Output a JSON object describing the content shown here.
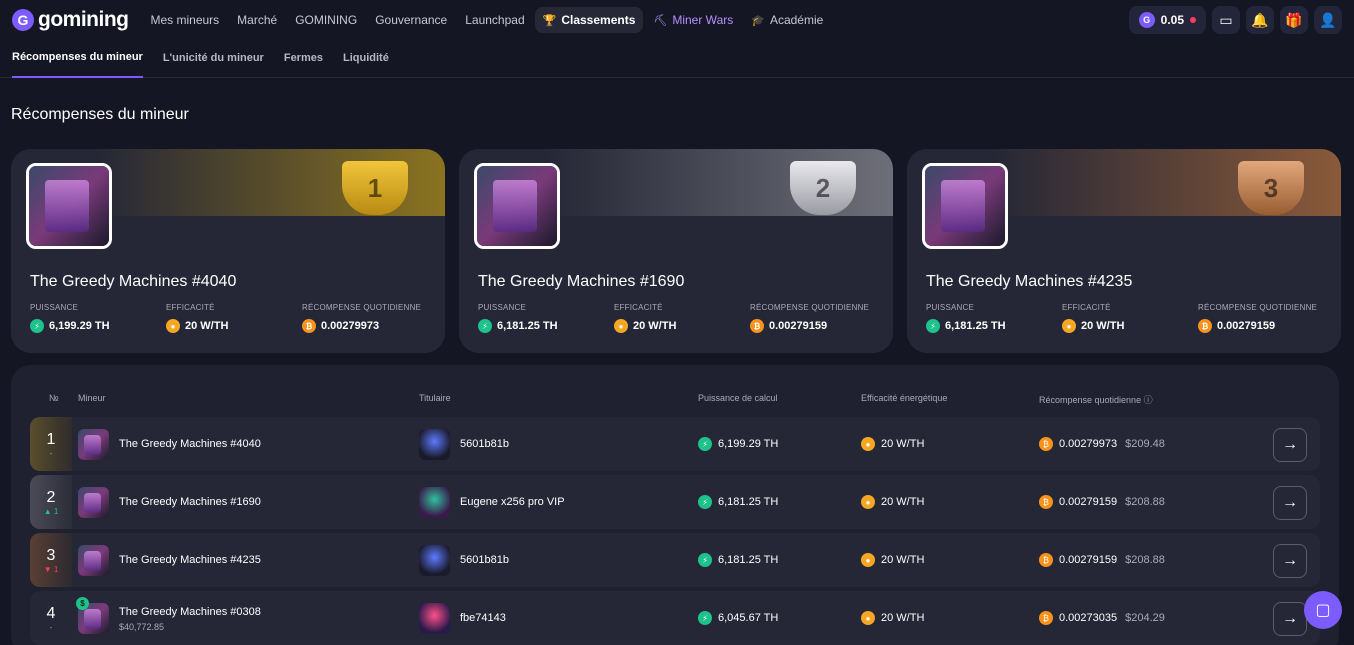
{
  "brand": {
    "logo_letter": "G",
    "logo_text": "gomining"
  },
  "nav": [
    {
      "label": "Mes mineurs"
    },
    {
      "label": "Marché"
    },
    {
      "label": "GOMINING"
    },
    {
      "label": "Gouvernance"
    },
    {
      "label": "Launchpad"
    },
    {
      "label": "Classements",
      "icon": "🏆"
    },
    {
      "label": "Miner Wars",
      "icon": "⛏"
    },
    {
      "label": "Académie",
      "icon": "🎓"
    }
  ],
  "header": {
    "balance": "0.05",
    "coin_letter": "G"
  },
  "subtabs": [
    "Récompenses du mineur",
    "L'unicité du mineur",
    "Fermes",
    "Liquidité"
  ],
  "section_title": "Récompenses du mineur",
  "podium": [
    {
      "rank_label": "1",
      "name": "The Greedy Machines #4040",
      "power": "6,199.29 TH",
      "efficiency": "20 W/TH",
      "reward": "0.00279973"
    },
    {
      "rank_label": "2",
      "name": "The Greedy Machines #1690",
      "power": "6,181.25 TH",
      "efficiency": "20 W/TH",
      "reward": "0.00279159"
    },
    {
      "rank_label": "3",
      "name": "The Greedy Machines #4235",
      "power": "6,181.25 TH",
      "efficiency": "20 W/TH",
      "reward": "0.00279159"
    }
  ],
  "stat_labels": {
    "power": "PUISSANCE",
    "efficiency": "EFFICACITÉ",
    "reward": "RÉCOMPENSE QUOTIDIENNE"
  },
  "table": {
    "headers": {
      "rank": "№",
      "miner": "Mineur",
      "owner": "Titulaire",
      "power": "Puissance de calcul",
      "efficiency": "Efficacité énergétique",
      "reward": "Récompense quotidienne ⓘ"
    },
    "rows": [
      {
        "rank": "1",
        "delta": "-",
        "name": "The Greedy Machines #4040",
        "owner": "5601b81b",
        "power": "6,199.29 TH",
        "efficiency": "20 W/TH",
        "reward": "0.00279973",
        "usd": "$209.48"
      },
      {
        "rank": "2",
        "delta": "▲ 1",
        "name": "The Greedy Machines #1690",
        "owner": "Eugene x256 pro VIP",
        "power": "6,181.25 TH",
        "efficiency": "20 W/TH",
        "reward": "0.00279159",
        "usd": "$208.88"
      },
      {
        "rank": "3",
        "delta": "▼ 1",
        "name": "The Greedy Machines #4235",
        "owner": "5601b81b",
        "power": "6,181.25 TH",
        "efficiency": "20 W/TH",
        "reward": "0.00279159",
        "usd": "$208.88"
      },
      {
        "rank": "4",
        "delta": "-",
        "name": "The Greedy Machines #0308",
        "price": "$40,772.85",
        "owner": "fbe74143",
        "power": "6,045.67 TH",
        "efficiency": "20 W/TH",
        "reward": "0.00273035",
        "usd": "$204.29"
      }
    ]
  },
  "icons": {
    "bolt": "⚡",
    "bulb": "●",
    "btc": "₿",
    "arrow": "→",
    "dollar": "$"
  },
  "colors": {
    "accent": "#7c5cff",
    "green": "#1ec28b",
    "btc": "#f7931a",
    "yellow": "#f5a623"
  }
}
